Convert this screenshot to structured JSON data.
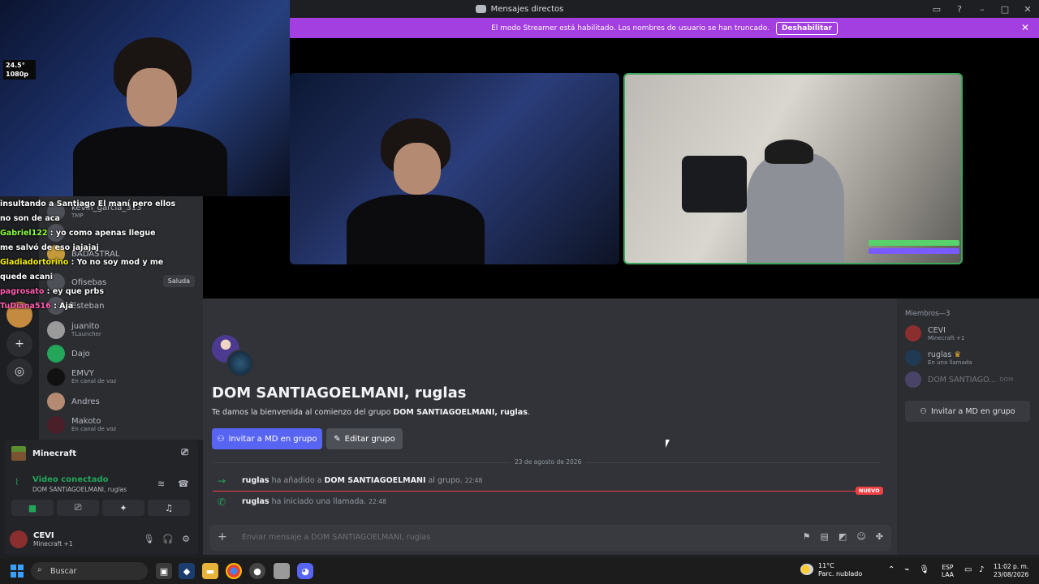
{
  "titlebar": {
    "title": "Mensajes directos"
  },
  "banner": {
    "text": "El modo Streamer está habilitado. Los nombres de usuario se han truncado.",
    "button": "Deshabilitar"
  },
  "dm_list": [
    {
      "name": "kevin_garcia_313",
      "sub": "TMP"
    },
    {
      "name": "",
      "sub": "CUAK"
    },
    {
      "name": "BADASTRAL",
      "sub": ""
    },
    {
      "name": "Ofisebas",
      "sub": "",
      "action": "Saluda"
    },
    {
      "name": "Esteban",
      "sub": ""
    },
    {
      "name": "juanito",
      "sub": "TLauncher"
    },
    {
      "name": "Dajo",
      "sub": ""
    },
    {
      "name": "EMVY",
      "sub": "En canal de voz"
    },
    {
      "name": "Andres",
      "sub": ""
    },
    {
      "name": "Makoto",
      "sub": "En canal de voz"
    }
  ],
  "chat_overlay": [
    {
      "nick": "",
      "text": "insultando a Santiago El maní pero ellos"
    },
    {
      "nick": "",
      "text": "no son de aca"
    },
    {
      "nick": "Gabriel122",
      "text": ": yo como apenas llegue"
    },
    {
      "nick": "",
      "text": "me salvó de eso jajajaj"
    },
    {
      "nick": "Gladiadortorino",
      "text": ": Yo no soy mod y me"
    },
    {
      "nick": "",
      "text": "quede acani"
    },
    {
      "nick": "pagrosato",
      "text": ": ey que prbs"
    },
    {
      "nick": "TuDiana516",
      "text": ": Ajá"
    }
  ],
  "voice_panel": {
    "activity": "Minecraft",
    "status": "Video conectado",
    "channel": "DOM SANTIAGOELMANI, ruglas",
    "user_name": "CEVI",
    "user_sub": "Minecraft +1"
  },
  "group": {
    "title": "DOM SANTIAGOELMANI, ruglas",
    "welcome_prefix": "Te damos la bienvenida al comienzo del grupo",
    "welcome_name": "DOM SANTIAGOELMANI, ruglas",
    "welcome_suffix": ".",
    "invite_button": "Invitar a MD en grupo",
    "edit_button": "Editar grupo"
  },
  "messages": {
    "date": "23 de agosto de 2026",
    "m1_user": "ruglas",
    "m1_mid": "ha añadido a",
    "m1_target": "DOM SANTIAGOELMANI",
    "m1_end": "al grupo.",
    "m1_time": "22:48",
    "m2_user": "ruglas",
    "m2_text": "ha iniciado una llamada.",
    "m2_time": "22:48",
    "new_badge": "NUEVO"
  },
  "composer": {
    "placeholder": "Enviar mensaje a DOM SANTIAGOELMANI, ruglas"
  },
  "members": {
    "header": "Miembros—3",
    "list": [
      {
        "name": "CEVI",
        "sub": "Minecraft +1",
        "tag": ""
      },
      {
        "name": "ruglas",
        "sub": "En una llamada",
        "tag": ""
      },
      {
        "name": "DOM SANTIAGO...",
        "sub": "",
        "tag": "DOM"
      }
    ],
    "invite_button": "Invitar a MD en grupo"
  },
  "taskbar": {
    "search_placeholder": "Buscar",
    "weather_temp": "11°C",
    "weather_desc": "Parc. nublado",
    "lang_top": "ESP",
    "lang_bottom": "LAA",
    "time": "11:02 p. m.",
    "date": "23/08/2026"
  },
  "cam_hud": {
    "text1": "24.5°",
    "text2": "1080p"
  }
}
